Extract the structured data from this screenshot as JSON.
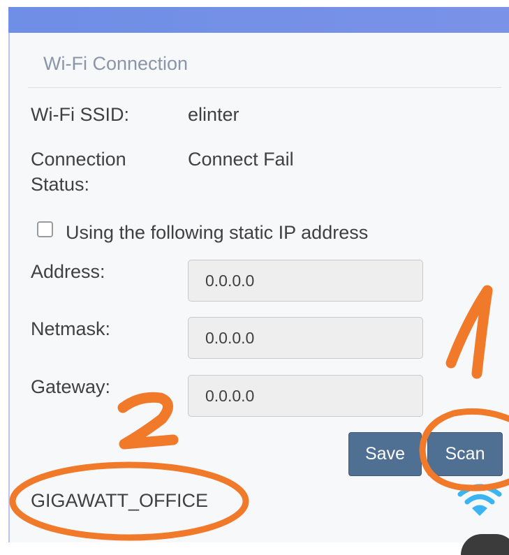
{
  "section_title": "Wi-Fi Connection",
  "ssid": {
    "label": "Wi-Fi SSID:",
    "value": "elinter"
  },
  "status": {
    "label_line1": "Connection",
    "label_line2": "Status:",
    "value": "Connect Fail"
  },
  "static_ip": {
    "checkbox_label": "Using the following static IP address",
    "checked": false,
    "address": {
      "label": "Address:",
      "value": "0.0.0.0"
    },
    "netmask": {
      "label": "Netmask:",
      "value": "0.0.0.0"
    },
    "gateway": {
      "label": "Gateway:",
      "value": "0.0.0.0"
    }
  },
  "buttons": {
    "save": "Save",
    "scan": "Scan"
  },
  "networks": [
    {
      "ssid": "GIGAWATT_OFFICE",
      "icon": "wifi-icon"
    }
  ],
  "annotations": {
    "mark1": "1",
    "mark2": "2",
    "color": "#f07a2a"
  },
  "colors": {
    "header": "#7590e6",
    "button": "#4f6f93",
    "wifi": "#3ab4f2"
  }
}
